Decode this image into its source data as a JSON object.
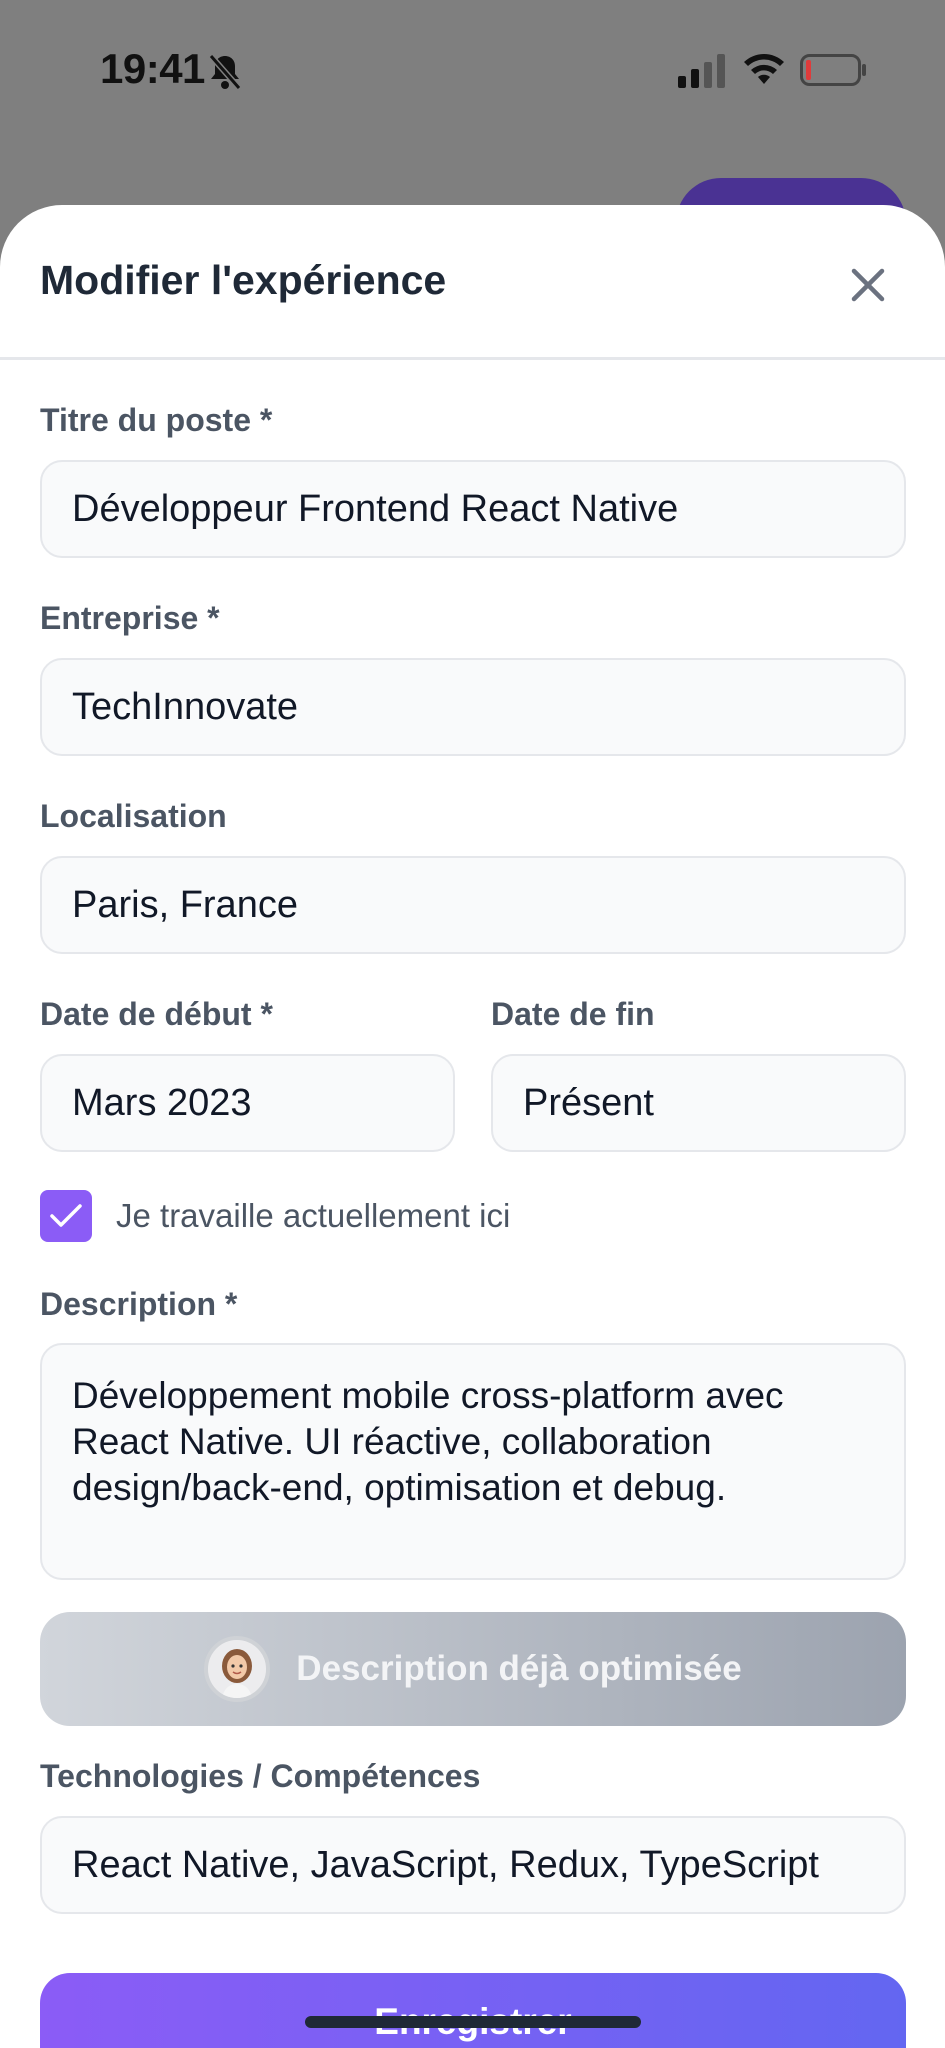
{
  "status_bar": {
    "time": "19:41"
  },
  "modal": {
    "title": "Modifier l'expérience",
    "close_icon": "close-icon"
  },
  "form": {
    "job_title": {
      "label": "Titre du poste *",
      "value": "Développeur Frontend React Native"
    },
    "company": {
      "label": "Entreprise *",
      "value": "TechInnovate"
    },
    "location": {
      "label": "Localisation",
      "value": "Paris, France"
    },
    "start_date": {
      "label": "Date de début *",
      "value": "Mars 2023"
    },
    "end_date": {
      "label": "Date de fin",
      "value": "Présent"
    },
    "current_job": {
      "label": "Je travaille actuellement ici",
      "checked": true
    },
    "description": {
      "label": "Description *",
      "value": "Développement mobile cross-platform avec React Native. UI réactive, collaboration design/back-end, optimisation et debug."
    },
    "optimize_button": "Description déjà optimisée",
    "technologies": {
      "label": "Technologies / Compétences",
      "value": "React Native, JavaScript, Redux, TypeScript"
    },
    "save_button": "Enregistrer"
  },
  "colors": {
    "accent": "#8b5cf6",
    "accent_end": "#6366f1",
    "title": "#1f2937",
    "label": "#4b5563"
  }
}
